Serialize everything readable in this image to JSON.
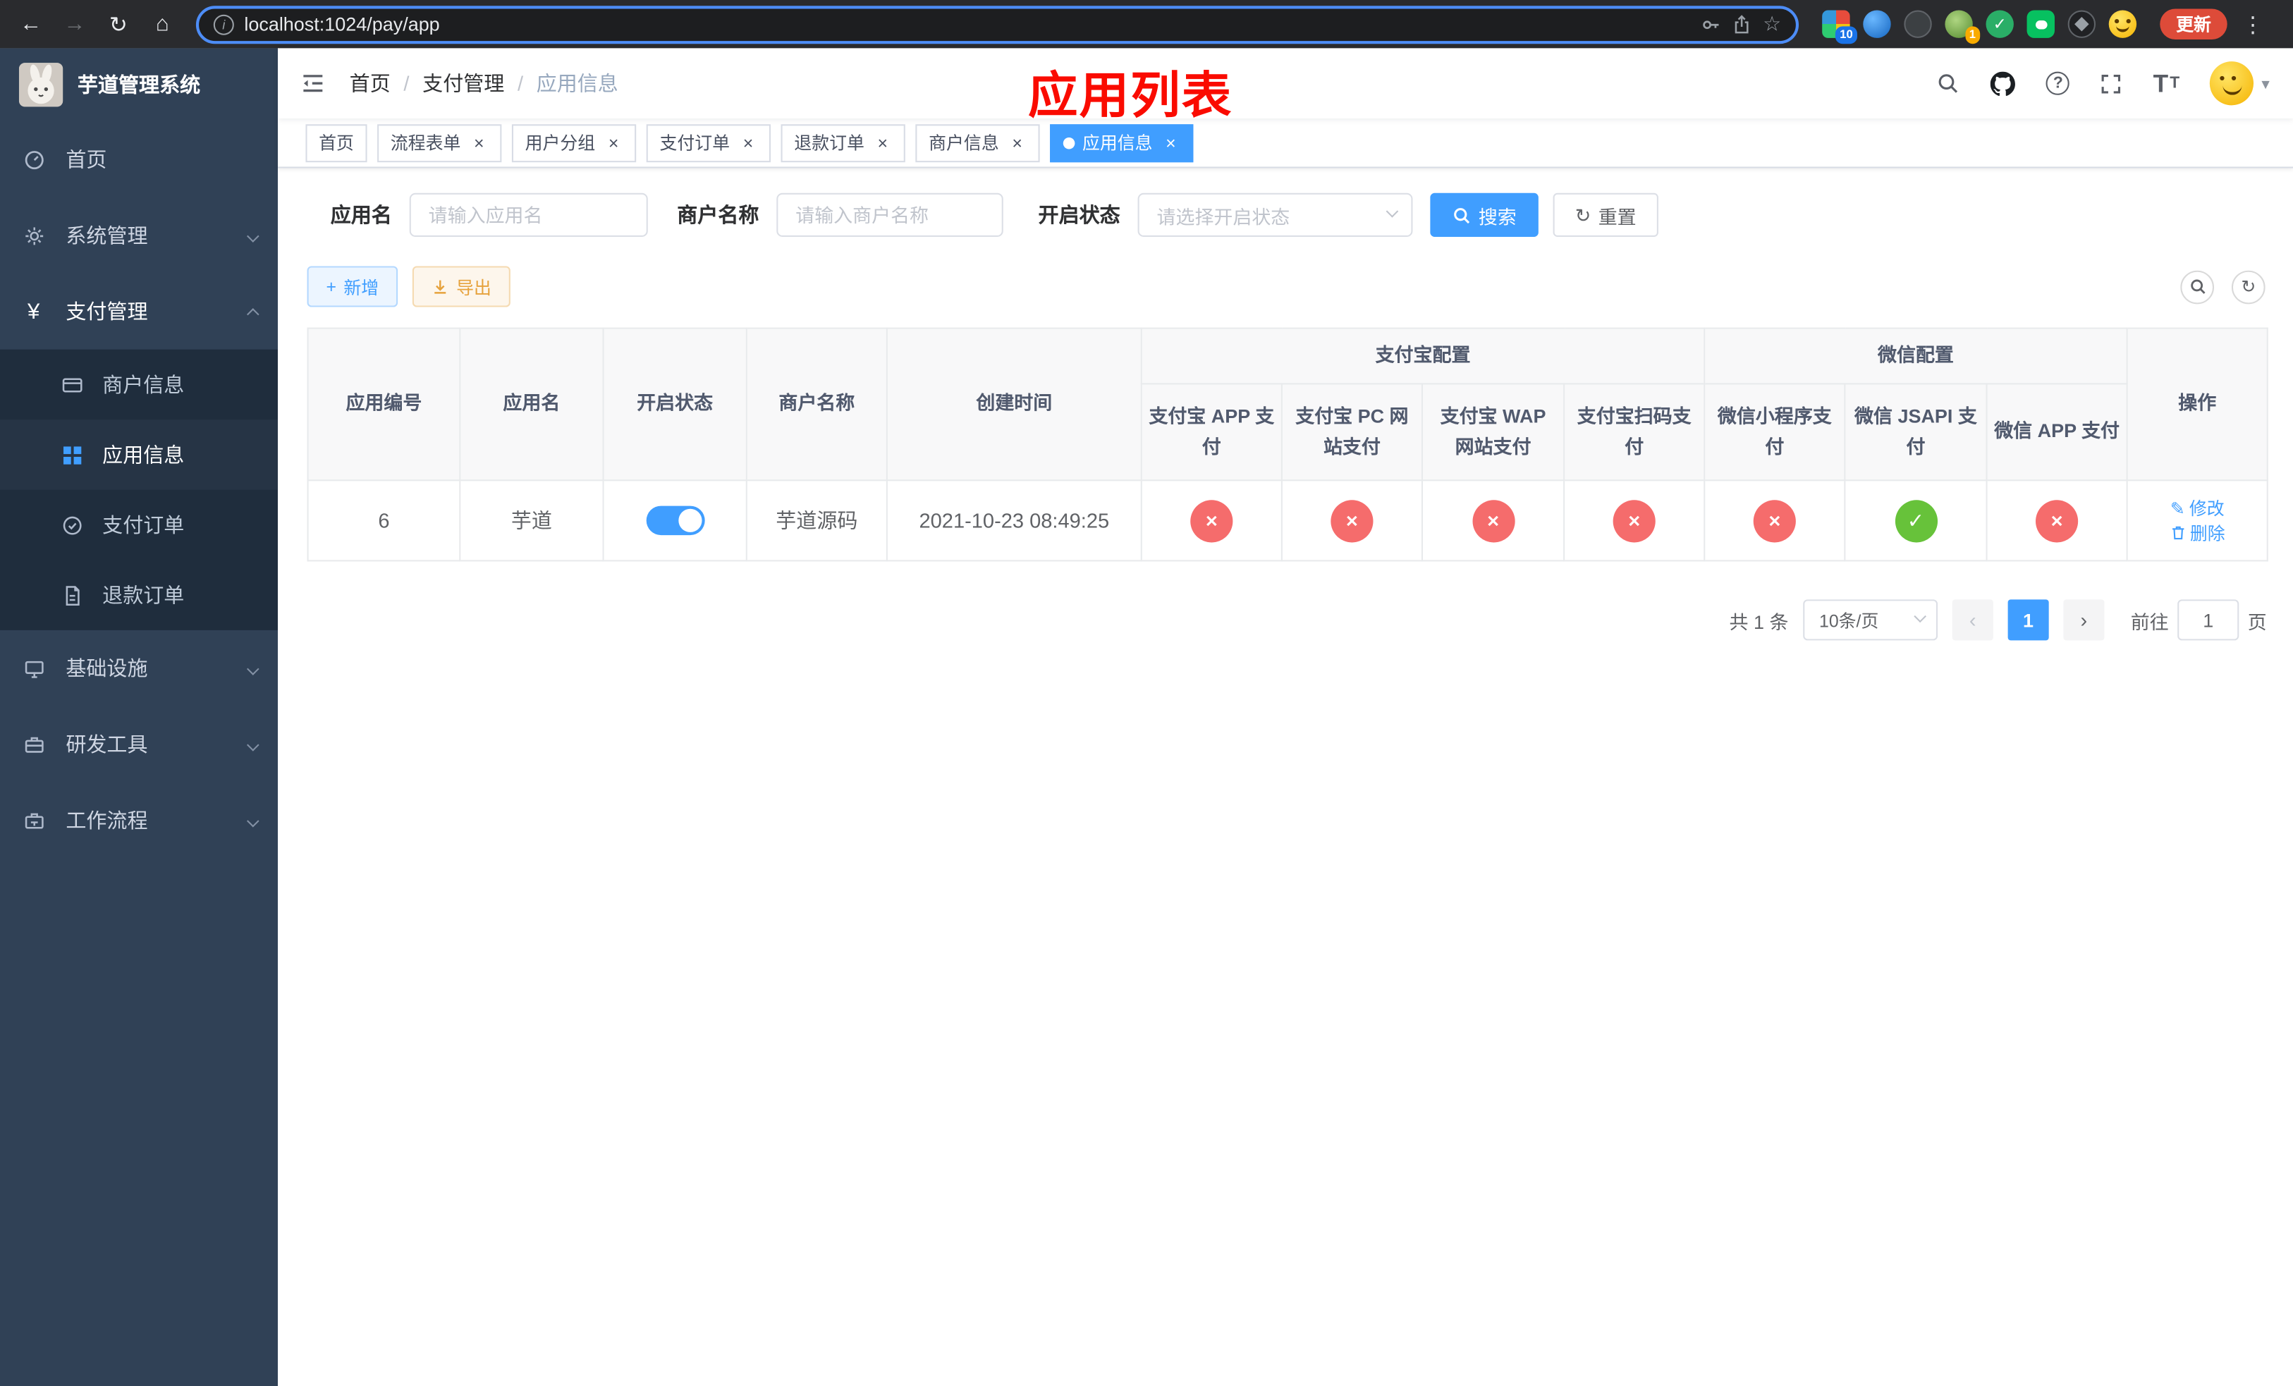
{
  "colors": {
    "primary": "#409EFF",
    "success": "#67C23A",
    "danger": "#F56C6C",
    "warning": "#E6A23C",
    "annotation_red": "#FA0B00",
    "sidebar_bg": "#304156",
    "sidebar_submenu_bg": "#1F2D3D"
  },
  "browser": {
    "url": "localhost:1024/pay/app",
    "update_label": "更新",
    "ext_badge_pixel": "10",
    "ext_badge_avatar": "1"
  },
  "sidebar": {
    "app_title": "芋道管理系统",
    "items": [
      {
        "label": "首页"
      },
      {
        "label": "系统管理"
      },
      {
        "label": "支付管理"
      },
      {
        "label": "基础设施"
      },
      {
        "label": "研发工具"
      },
      {
        "label": "工作流程"
      }
    ],
    "payment_submenu": [
      {
        "label": "商户信息"
      },
      {
        "label": "应用信息"
      },
      {
        "label": "支付订单"
      },
      {
        "label": "退款订单"
      }
    ]
  },
  "header": {
    "breadcrumb": [
      {
        "label": "首页"
      },
      {
        "label": "支付管理"
      },
      {
        "label": "应用信息"
      }
    ],
    "separator": "/",
    "annotation": "应用列表"
  },
  "tabs": [
    {
      "label": "首页"
    },
    {
      "label": "流程表单"
    },
    {
      "label": "用户分组"
    },
    {
      "label": "支付订单"
    },
    {
      "label": "退款订单"
    },
    {
      "label": "商户信息"
    },
    {
      "label": "应用信息"
    }
  ],
  "filters": {
    "app_name": {
      "label": "应用名",
      "placeholder": "请输入应用名",
      "value": ""
    },
    "merchant_name": {
      "label": "商户名称",
      "placeholder": "请输入商户名称",
      "value": ""
    },
    "status": {
      "label": "开启状态",
      "placeholder": "请选择开启状态",
      "value": ""
    },
    "search_label": "搜索",
    "reset_label": "重置"
  },
  "toolbar": {
    "add_label": "新增",
    "export_label": "导出"
  },
  "table": {
    "group_alipay": "支付宝配置",
    "group_wechat": "微信配置",
    "columns": {
      "id": "应用编号",
      "name": "应用名",
      "status": "开启状态",
      "merchant": "商户名称",
      "created": "创建时间",
      "alipay_app": "支付宝 APP 支付",
      "alipay_pc": "支付宝 PC 网站支付",
      "alipay_wap": "支付宝 WAP 网站支付",
      "alipay_qr": "支付宝扫码支付",
      "wx_lite": "微信小程序支付",
      "wx_jsapi": "微信 JSAPI 支付",
      "wx_app": "微信 APP 支付",
      "actions": "操作"
    },
    "rows": [
      {
        "id": "6",
        "name": "芋道",
        "enabled": "on",
        "merchant": "芋道源码",
        "created": "2021-10-23 08:49:25",
        "alipay_app": {
          "state": "fail",
          "glyph": "×"
        },
        "alipay_pc": {
          "state": "fail",
          "glyph": "×"
        },
        "alipay_wap": {
          "state": "fail",
          "glyph": "×"
        },
        "alipay_qr": {
          "state": "fail",
          "glyph": "×"
        },
        "wx_lite": {
          "state": "fail",
          "glyph": "×"
        },
        "wx_jsapi": {
          "state": "success",
          "glyph": "✓"
        },
        "wx_app": {
          "state": "fail",
          "glyph": "×"
        },
        "edit_label": "修改",
        "delete_label": "删除"
      }
    ]
  },
  "pagination": {
    "total_text": "共 1 条",
    "page_size_text": "10条/页",
    "current_page": "1",
    "goto_label": "前往",
    "goto_value": "1",
    "goto_unit": "页"
  },
  "icons": {
    "back": "←",
    "forward": "→",
    "reload": "↻",
    "home": "⌂",
    "info": "i",
    "star": "☆",
    "more": "⋮",
    "plus": "+",
    "question": "?",
    "check": "✓",
    "cross": "×",
    "edit": "✎",
    "yen": "¥",
    "prev": "‹",
    "next": "›",
    "caret_down": "▾",
    "font_size_large": "T",
    "font_size_small": "T"
  }
}
